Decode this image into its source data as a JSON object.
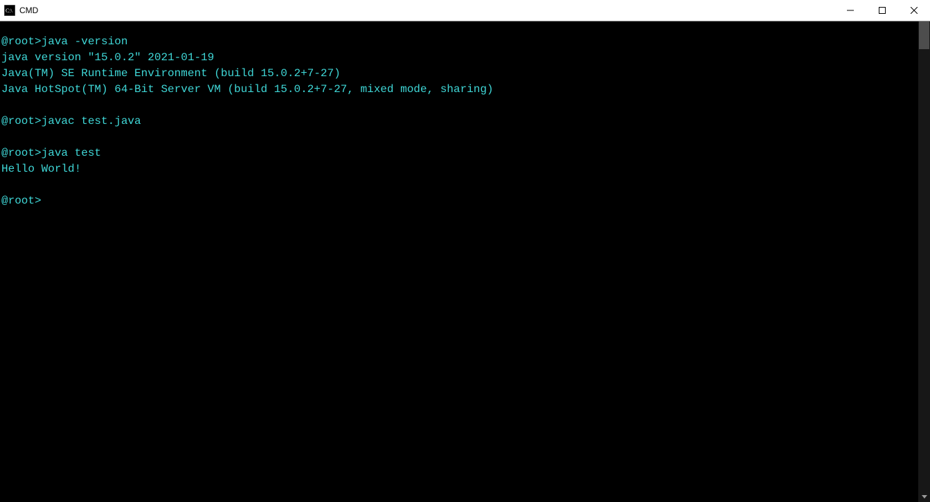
{
  "window": {
    "title": "CMD"
  },
  "terminal": {
    "lines": [
      "@root>java -version",
      "java version \"15.0.2\" 2021-01-19",
      "Java(TM) SE Runtime Environment (build 15.0.2+7-27)",
      "Java HotSpot(TM) 64-Bit Server VM (build 15.0.2+7-27, mixed mode, sharing)",
      "",
      "@root>javac test.java",
      "",
      "@root>java test",
      "Hello World!",
      "",
      "@root>"
    ]
  }
}
